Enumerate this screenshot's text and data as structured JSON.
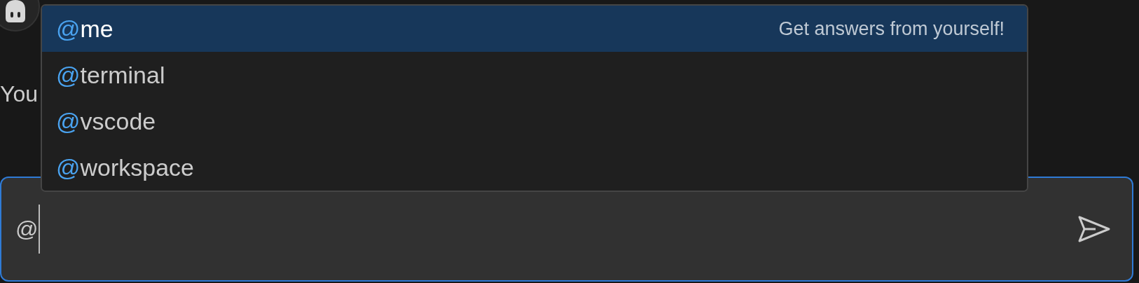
{
  "message": {
    "author": "You"
  },
  "mention_menu": {
    "items": [
      {
        "prefix": "@",
        "name": "me",
        "description": "Get answers from yourself!",
        "selected": true
      },
      {
        "prefix": "@",
        "name": "terminal",
        "selected": false
      },
      {
        "prefix": "@",
        "name": "vscode",
        "selected": false
      },
      {
        "prefix": "@",
        "name": "workspace",
        "selected": false
      }
    ]
  },
  "chat_input": {
    "value": "@"
  }
}
